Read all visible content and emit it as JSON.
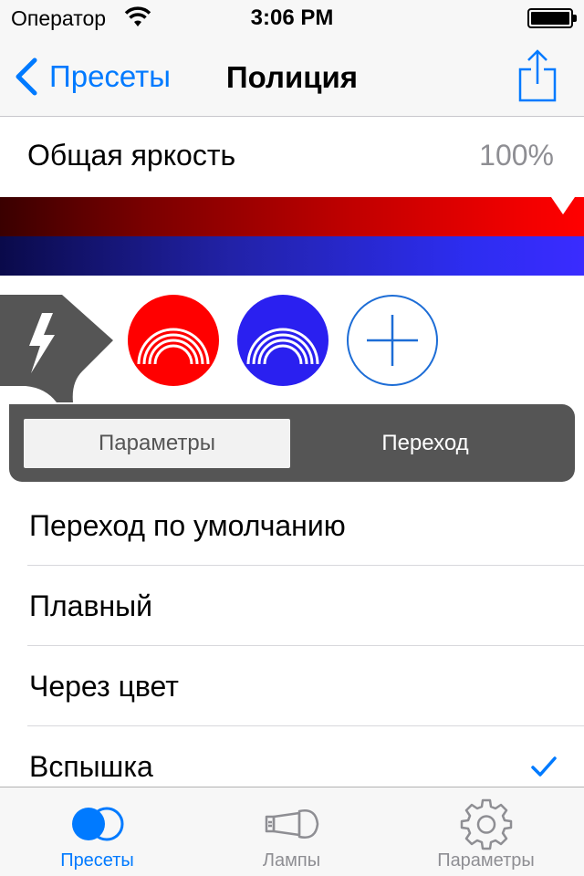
{
  "status_bar": {
    "carrier": "Оператор",
    "time": "3:06 PM",
    "icons": [
      "wifi-icon",
      "battery-icon"
    ]
  },
  "nav": {
    "back_label": "Пресеты",
    "title": "Полиция",
    "icons": [
      "chevron-left-icon",
      "share-icon"
    ]
  },
  "brightness": {
    "label": "Общая яркость",
    "value": "100%",
    "level_fraction": 1.0
  },
  "color_bars": [
    {
      "name": "red",
      "color": "#ff0000"
    },
    {
      "name": "blue",
      "color": "#2a20f0"
    }
  ],
  "effect": {
    "icon": "lightning-icon",
    "swatches": [
      {
        "color": "#ff0000",
        "icon": "rainbow-arc-icon"
      },
      {
        "color": "#2a20f0",
        "icon": "rainbow-arc-icon"
      }
    ],
    "add_icon": "plus-icon"
  },
  "segments": {
    "params_label": "Параметры",
    "transition_label": "Переход",
    "selected": "Параметры"
  },
  "transitions": {
    "items": [
      {
        "label": "Переход по умолчанию",
        "checked": false
      },
      {
        "label": "Плавный",
        "checked": false
      },
      {
        "label": "Через цвет",
        "checked": false
      },
      {
        "label": "Вспышка",
        "checked": true
      }
    ]
  },
  "tabbar": {
    "items": [
      {
        "label": "Пресеты",
        "icon": "presets-circles-icon",
        "active": true
      },
      {
        "label": "Лампы",
        "icon": "lamp-icon",
        "active": false
      },
      {
        "label": "Параметры",
        "icon": "gear-icon",
        "active": false
      }
    ]
  },
  "colors": {
    "accent": "#007aff",
    "panel": "#555555"
  }
}
